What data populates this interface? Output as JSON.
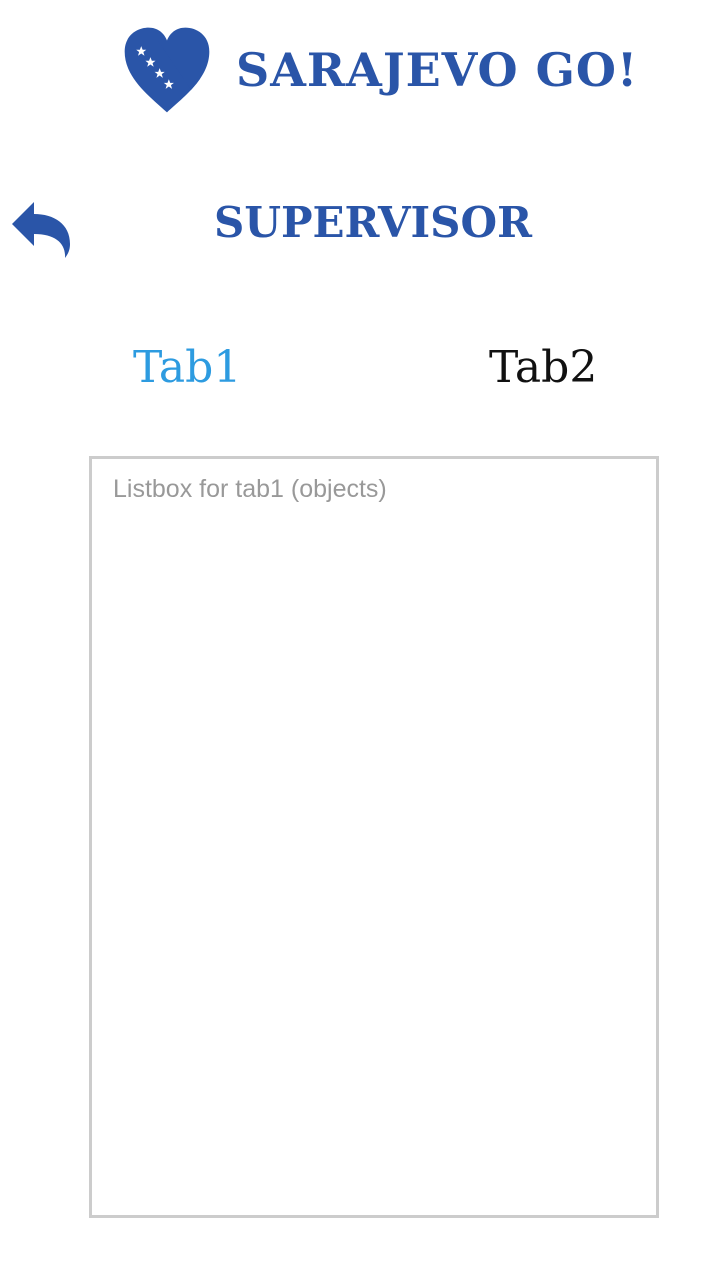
{
  "header": {
    "logo_text": "SARAJEVO GO!",
    "logo_icon": "bosnia-heart-icon",
    "brand_color": "#2a55a8"
  },
  "toolbar": {
    "back_icon": "reply-arrow-icon",
    "title": "SUPERVISOR"
  },
  "tabs": [
    {
      "label": "Tab1",
      "active": true,
      "color": "#2d9be0"
    },
    {
      "label": "Tab2",
      "active": false,
      "color": "#111111"
    }
  ],
  "listbox": {
    "placeholder": "Listbox for tab1 (objects)",
    "items": []
  }
}
